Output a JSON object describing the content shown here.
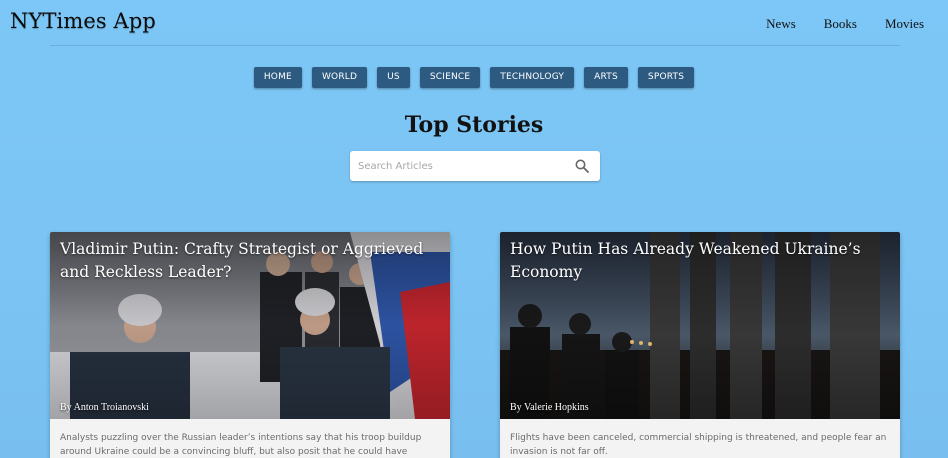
{
  "app": {
    "title": "NYTimes App"
  },
  "nav": {
    "links": [
      {
        "label": "News"
      },
      {
        "label": "Books"
      },
      {
        "label": "Movies"
      }
    ]
  },
  "categories": [
    {
      "label": "HOME"
    },
    {
      "label": "WORLD"
    },
    {
      "label": "US"
    },
    {
      "label": "SCIENCE"
    },
    {
      "label": "TECHNOLOGY"
    },
    {
      "label": "ARTS"
    },
    {
      "label": "SPORTS"
    }
  ],
  "main": {
    "title": "Top Stories",
    "search": {
      "placeholder": "Search Articles",
      "value": ""
    }
  },
  "articles": [
    {
      "title": "Vladimir Putin: Crafty Strategist or Aggrieved and Reckless Leader?",
      "byline": "By Anton Troianovski",
      "summary": "Analysts puzzling over the Russian leader’s intentions say that his troop buildup around Ukraine could be a convincing bluff, but also posit that he could have fundamentally"
    },
    {
      "title": "How Putin Has Already Weakened Ukraine’s Economy",
      "byline": "By Valerie Hopkins",
      "summary": "Flights have been canceled, commercial shipping is threatened, and people fear an invasion is not far off."
    }
  ],
  "theme": {
    "accent": "#2d5a80",
    "background": "#7cc7f7"
  },
  "icons": {
    "search": "search-icon"
  }
}
